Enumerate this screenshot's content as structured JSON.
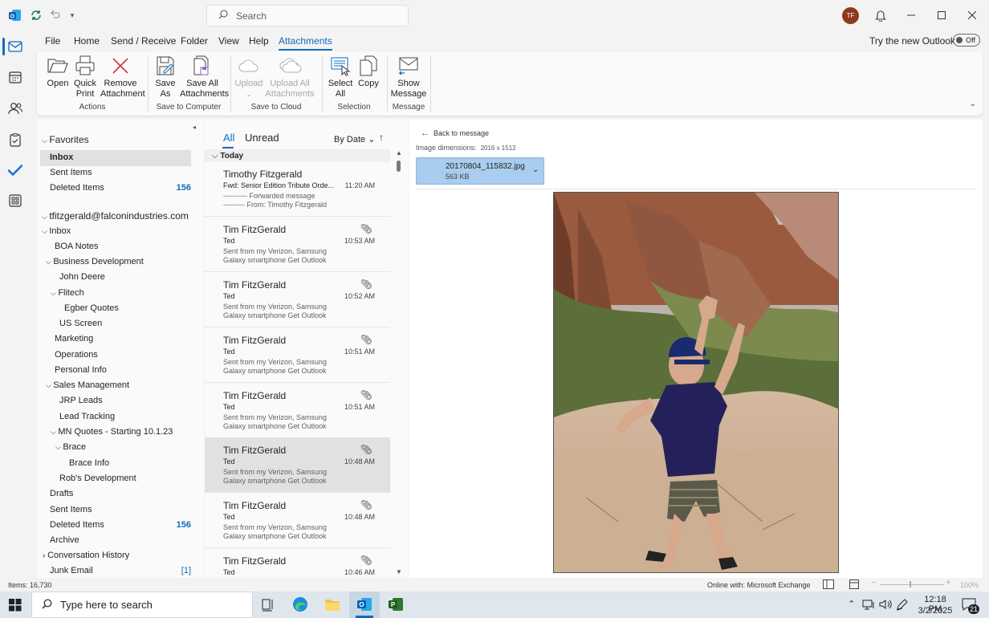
{
  "window": {
    "search_placeholder": "Search",
    "avatar_initials": "TF",
    "accent": "#0f6cbd"
  },
  "menu": {
    "items": [
      "File",
      "Home",
      "Send / Receive",
      "Folder",
      "View",
      "Help",
      "Attachments"
    ],
    "active": "Attachments",
    "try_new": "Try the new Outlook",
    "toggle_label": "Off"
  },
  "ribbon": {
    "open": "Open",
    "quick_print_1": "Quick",
    "quick_print_2": "Print",
    "remove_1": "Remove",
    "remove_2": "Attachment",
    "group_actions": "Actions",
    "save_as_1": "Save",
    "save_as_2": "As",
    "save_all_1": "Save All",
    "save_all_2": "Attachments",
    "group_save": "Save to Computer",
    "upload": "Upload",
    "upload_all_1": "Upload All",
    "upload_all_2": "Attachments",
    "group_cloud": "Save to Cloud",
    "select_all_1": "Select",
    "select_all_2": "All",
    "copy": "Copy",
    "group_selection": "Selection",
    "show_msg_1": "Show",
    "show_msg_2": "Message",
    "group_message": "Message"
  },
  "folders": {
    "favorites_title": "Favorites",
    "favorites": [
      {
        "label": "Inbox",
        "count": ""
      },
      {
        "label": "Sent Items",
        "count": ""
      },
      {
        "label": "Deleted Items",
        "count": "156"
      }
    ],
    "account": "tfitzgerald@falconindustries.com",
    "tree": [
      {
        "label": "Inbox",
        "count": ""
      },
      {
        "label": "BOA Notes",
        "count": ""
      },
      {
        "label": "Business Development",
        "count": ""
      },
      {
        "label": "John Deere",
        "count": ""
      },
      {
        "label": "Flitech",
        "count": ""
      },
      {
        "label": "Egber Quotes",
        "count": ""
      },
      {
        "label": "US Screen",
        "count": ""
      },
      {
        "label": "Marketing",
        "count": ""
      },
      {
        "label": "Operations",
        "count": ""
      },
      {
        "label": "Personal Info",
        "count": ""
      },
      {
        "label": "Sales Management",
        "count": ""
      },
      {
        "label": "JRP Leads",
        "count": ""
      },
      {
        "label": "Lead Tracking",
        "count": ""
      },
      {
        "label": "MN Quotes - Starting 10.1.23",
        "count": ""
      },
      {
        "label": "Brace",
        "count": ""
      },
      {
        "label": "Brace Info",
        "count": ""
      },
      {
        "label": "Rob's Development",
        "count": ""
      },
      {
        "label": "Drafts",
        "count": ""
      },
      {
        "label": "Sent Items",
        "count": ""
      },
      {
        "label": "Deleted Items",
        "count": "156"
      },
      {
        "label": "Archive",
        "count": ""
      },
      {
        "label": "Conversation History",
        "count": ""
      },
      {
        "label": "Junk Email",
        "count": "[1]"
      }
    ]
  },
  "list": {
    "tab_all": "All",
    "tab_unread": "Unread",
    "sort": "By Date",
    "group_today": "Today",
    "messages": [
      {
        "from": "Timothy Fitzgerald",
        "subject": "Fwd: Senior Edition Tribute Orde...",
        "time": "11:20 AM",
        "preview1": "---------- Forwarded message",
        "preview2": "--------- From: Timothy Fitzgerald"
      },
      {
        "from": "Tim FitzGerald",
        "subject": "Ted",
        "time": "10:53 AM",
        "preview1": "Sent from my Verizon, Samsung",
        "preview2": "Galaxy smartphone Get Outlook"
      },
      {
        "from": "Tim FitzGerald",
        "subject": "Ted",
        "time": "10:52 AM",
        "preview1": "Sent from my Verizon, Samsung",
        "preview2": "Galaxy smartphone Get Outlook"
      },
      {
        "from": "Tim FitzGerald",
        "subject": "Ted",
        "time": "10:51 AM",
        "preview1": "Sent from my Verizon, Samsung",
        "preview2": "Galaxy smartphone Get Outlook"
      },
      {
        "from": "Tim FitzGerald",
        "subject": "Ted",
        "time": "10:51 AM",
        "preview1": "Sent from my Verizon, Samsung",
        "preview2": "Galaxy smartphone Get Outlook"
      },
      {
        "from": "Tim FitzGerald",
        "subject": "Ted",
        "time": "10:48 AM",
        "preview1": "Sent from my Verizon, Samsung",
        "preview2": "Galaxy smartphone Get Outlook"
      },
      {
        "from": "Tim FitzGerald",
        "subject": "Ted",
        "time": "10:48 AM",
        "preview1": "Sent from my Verizon, Samsung",
        "preview2": "Galaxy smartphone Get Outlook"
      },
      {
        "from": "Tim FitzGerald",
        "subject": "Ted",
        "time": "10:46 AM",
        "preview1": "",
        "preview2": ""
      }
    ]
  },
  "reading": {
    "back": "Back to message",
    "dims_label": "Image dimensions:",
    "dims_value": "2016 x 1512",
    "file_name": "20170804_115832.jpg",
    "file_size": "563 KB"
  },
  "status": {
    "items": "Items: 16,730",
    "connection": "Online with: Microsoft Exchange",
    "zoom": "100%"
  },
  "taskbar": {
    "search_placeholder": "Type here to search",
    "time": "12:18 PM",
    "date": "3/2/2025",
    "notif_count": "21"
  }
}
